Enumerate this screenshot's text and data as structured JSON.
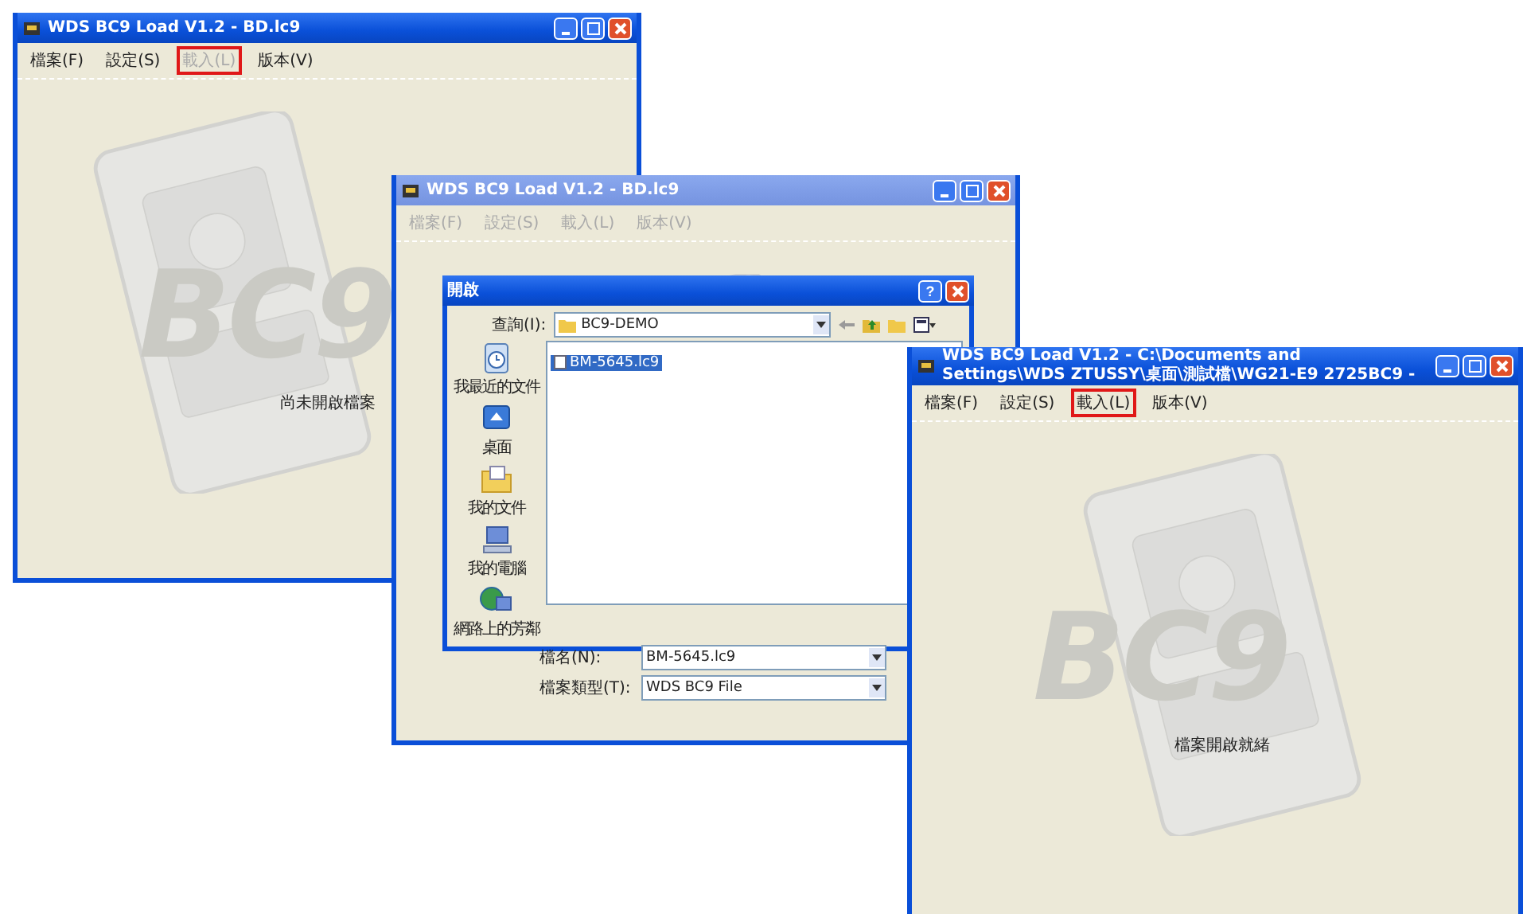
{
  "windows": [
    {
      "title": "WDS BC9 Load V1.2 - BD.lc9",
      "active": true,
      "menu": [
        {
          "label": "檔案(F)",
          "disabled": false,
          "highlighted": false
        },
        {
          "label": "設定(S)",
          "disabled": false,
          "highlighted": false
        },
        {
          "label": "載入(L)",
          "disabled": true,
          "highlighted": true
        },
        {
          "label": "版本(V)",
          "disabled": false,
          "highlighted": false
        }
      ],
      "logo_text": "BC9",
      "status_text": "尚未開啟檔案"
    },
    {
      "title": "WDS BC9 Load V1.2 - BD.lc9",
      "active": false,
      "menu": [
        {
          "label": "檔案(F)",
          "disabled": true,
          "highlighted": false
        },
        {
          "label": "設定(S)",
          "disabled": true,
          "highlighted": false
        },
        {
          "label": "載入(L)",
          "disabled": true,
          "highlighted": false
        },
        {
          "label": "版本(V)",
          "disabled": true,
          "highlighted": false
        }
      ],
      "dialog": {
        "title": "開啟",
        "help_button": "?",
        "look_in_label": "查詢(I):",
        "look_in_value": "BC9-DEMO",
        "places": [
          {
            "kind": "recent",
            "label": "我最近的文件"
          },
          {
            "kind": "desktop",
            "label": "桌面"
          },
          {
            "kind": "documents",
            "label": "我的文件"
          },
          {
            "kind": "computer",
            "label": "我的電腦"
          },
          {
            "kind": "network",
            "label": "網路上的芳鄰"
          }
        ],
        "files": [
          {
            "name": "BM-5645.lc9",
            "selected": true
          }
        ],
        "filename_label": "檔名(N):",
        "filename_value": "BM-5645.lc9",
        "filetype_label": "檔案類型(T):",
        "filetype_value": "WDS BC9 File"
      }
    },
    {
      "title": "WDS BC9 Load V1.2 - C:\\Documents and Settings\\WDS ZTUSSY\\桌面\\測試檔\\WG21-E9 2725BC9 -",
      "active": true,
      "menu": [
        {
          "label": "檔案(F)",
          "disabled": false,
          "highlighted": false
        },
        {
          "label": "設定(S)",
          "disabled": false,
          "highlighted": false
        },
        {
          "label": "載入(L)",
          "disabled": false,
          "highlighted": true
        },
        {
          "label": "版本(V)",
          "disabled": false,
          "highlighted": false
        }
      ],
      "logo_text": "BC9",
      "status_text": "檔案開啟就緒"
    }
  ]
}
